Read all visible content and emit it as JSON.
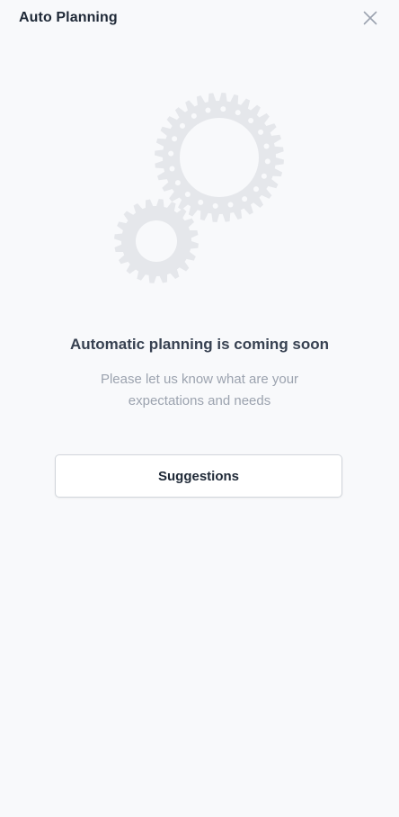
{
  "header": {
    "title": "Auto Planning",
    "close_icon": "close-icon"
  },
  "illustration": {
    "icon": "gears-icon",
    "color": "#e5e7eb"
  },
  "main": {
    "heading": "Automatic planning is coming soon",
    "subtext": "Please let us know what are your expectations and needs",
    "button_label": "Suggestions"
  },
  "colors": {
    "background": "#f8f9fb",
    "title": "#1f2937",
    "heading": "#374151",
    "subtext": "#9ca3af",
    "button_border": "#d1d5db"
  }
}
